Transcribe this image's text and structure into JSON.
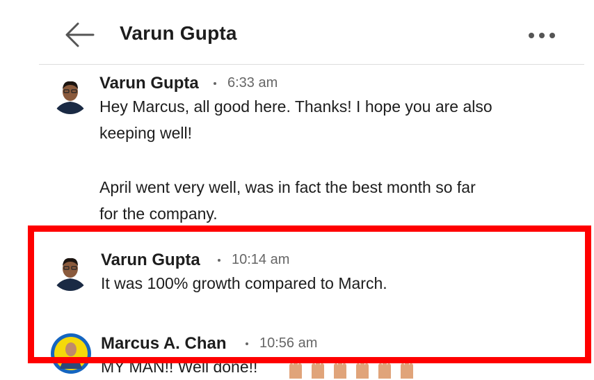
{
  "header": {
    "title": "Varun Gupta",
    "back_icon": "arrow-left-icon",
    "more_icon": "more-horizontal-icon"
  },
  "messages": [
    {
      "sender": "Varun Gupta",
      "time": "6:33 am",
      "lines": [
        "Hey Marcus, all good here. Thanks! I hope you are also",
        "keeping well!",
        "",
        "April went very well, was in fact the best month so far",
        "for the company."
      ]
    },
    {
      "sender": "Varun Gupta",
      "time": "10:14 am",
      "lines": [
        "It was 100% growth compared to March."
      ]
    },
    {
      "sender": "Marcus A. Chan",
      "time": "10:56 am",
      "lines": [
        "MY MAN!! Well done!!"
      ]
    }
  ],
  "colors": {
    "highlight": "#ff0000",
    "text": "#1d1d1d",
    "muted": "#666666",
    "avatar_ring": "#1565c0",
    "avatar_bg": "#f5d90a"
  }
}
